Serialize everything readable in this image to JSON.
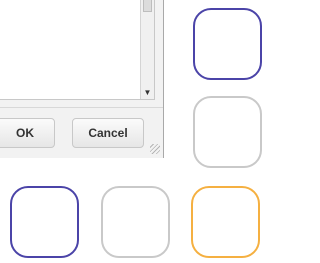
{
  "dialog": {
    "ok_label": "OK",
    "cancel_label": "Cancel",
    "scroll_down_icon": "▼"
  },
  "tiles": [
    {
      "id": "a",
      "color": "#4b44a8"
    },
    {
      "id": "b",
      "color": "#c9c9c9"
    },
    {
      "id": "c",
      "color": "#4b44a8"
    },
    {
      "id": "d",
      "color": "#c9c9c9"
    },
    {
      "id": "e",
      "color": "#f5b041"
    }
  ]
}
